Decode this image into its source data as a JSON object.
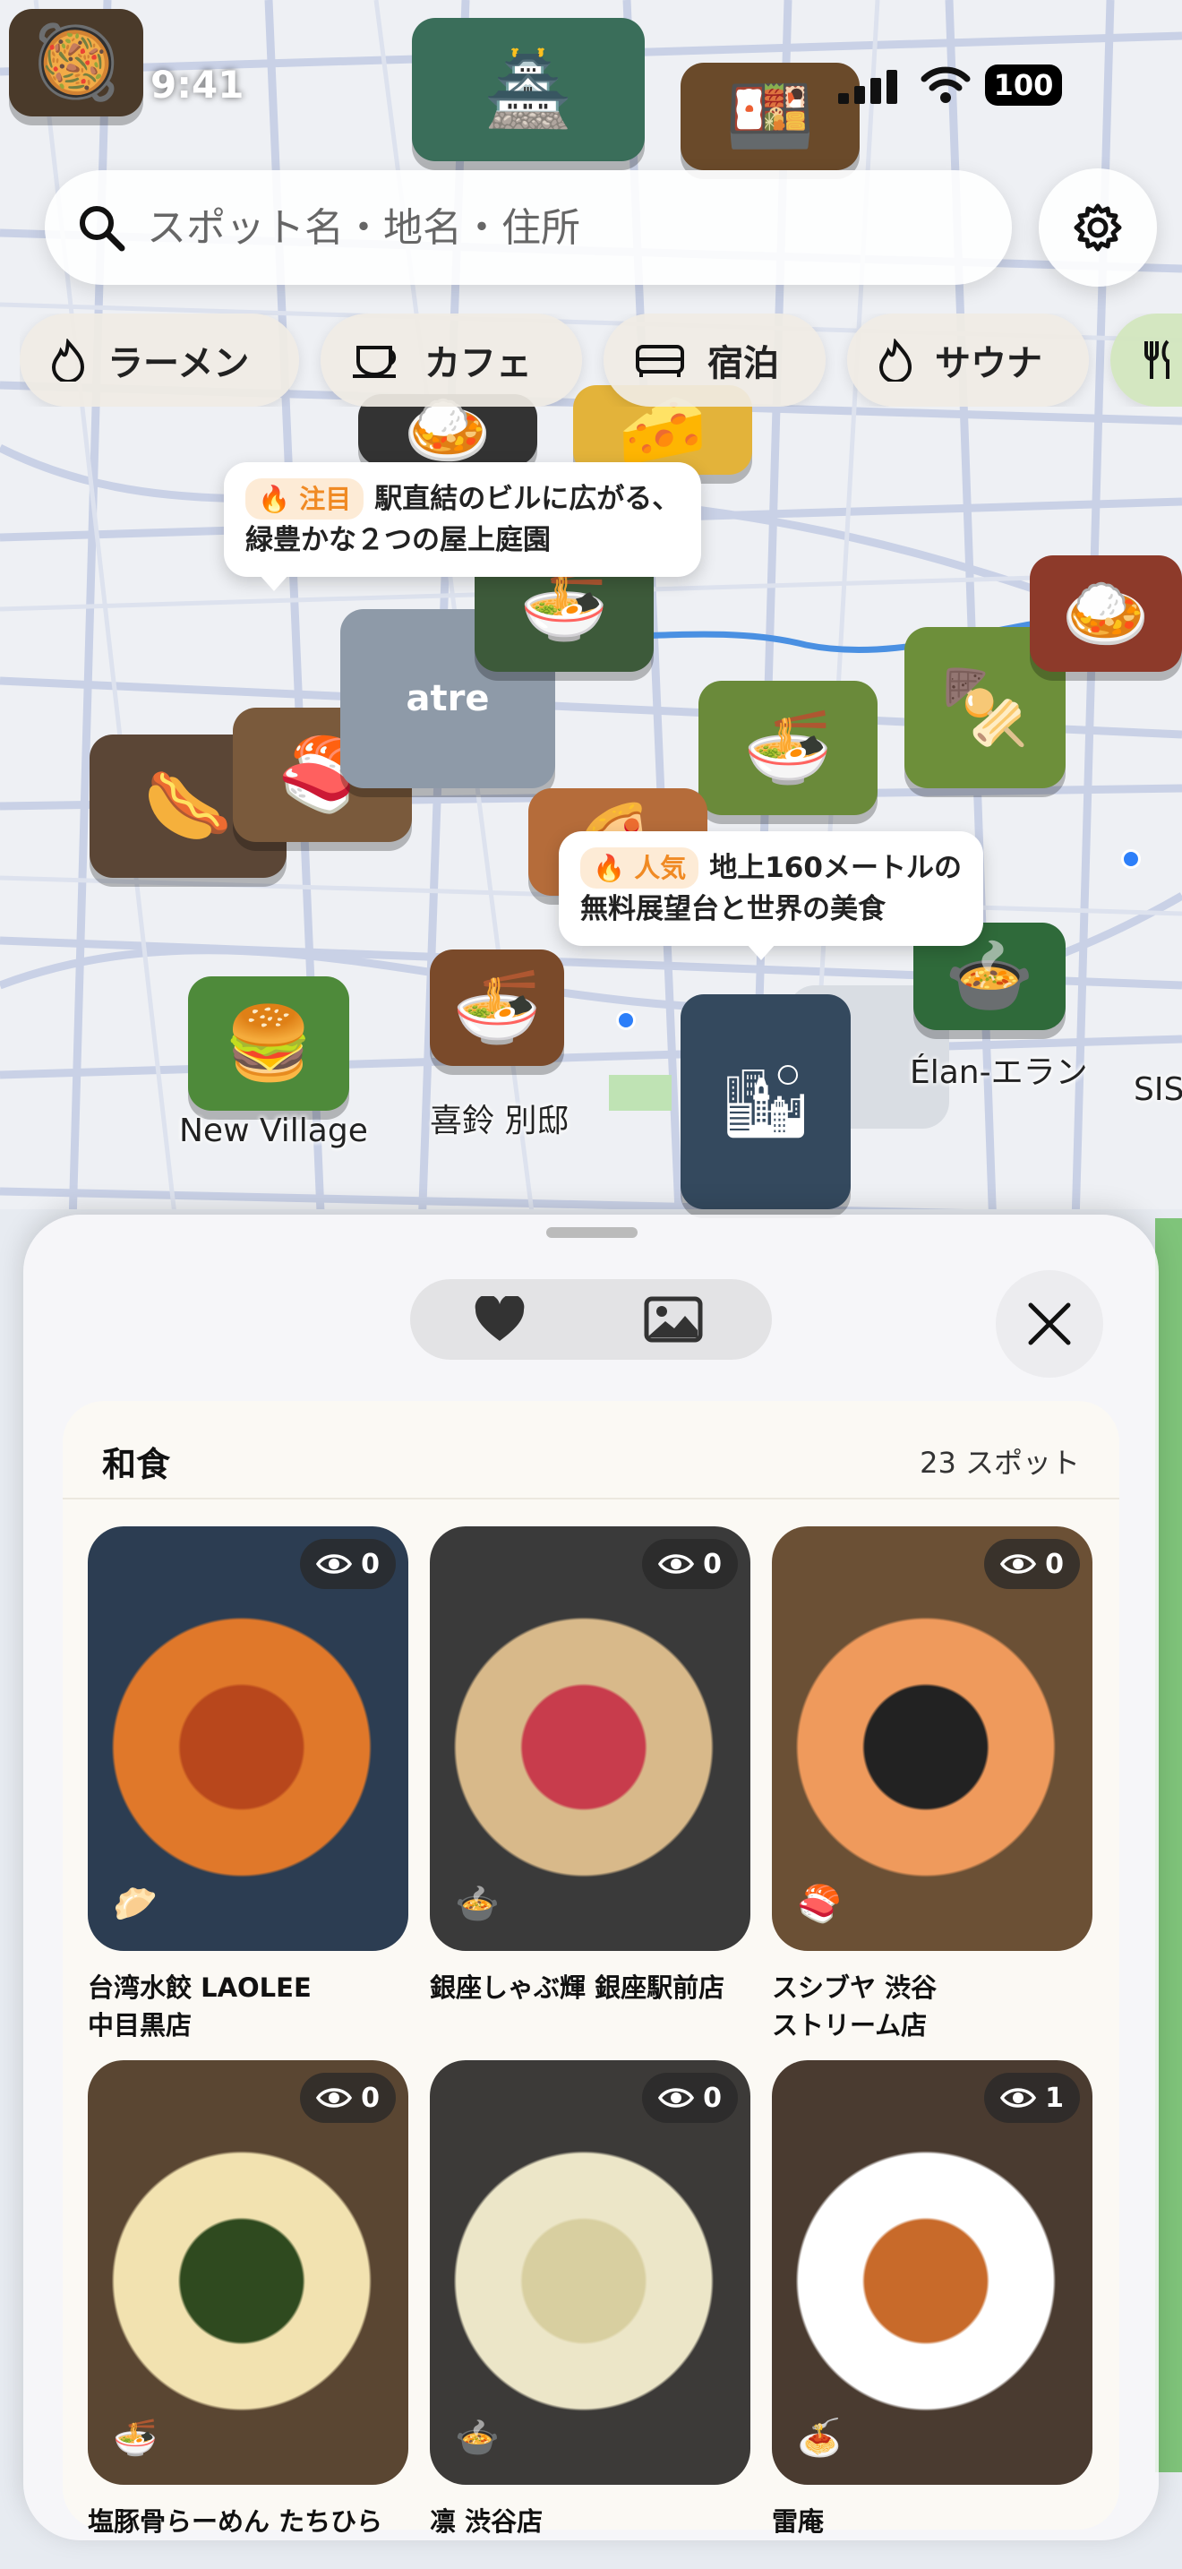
{
  "status_bar": {
    "time": "9:41",
    "battery": "100"
  },
  "search": {
    "placeholder": "スポット名・地名・住所"
  },
  "chips": [
    {
      "label": "ラーメン",
      "icon": "flame-icon"
    },
    {
      "label": "カフェ",
      "icon": "coffee-cup-icon"
    },
    {
      "label": "宿泊",
      "icon": "bed-icon"
    },
    {
      "label": "サウナ",
      "icon": "flame-icon"
    },
    {
      "label": "",
      "icon": "fork-knife-icon"
    }
  ],
  "map": {
    "callouts": [
      {
        "tag": "注目",
        "line1": "駅直結のビルに広がる、",
        "line2": "緑豊かな２つの屋上庭園"
      },
      {
        "tag": "人気",
        "line1": "地上160メートルの",
        "line2": "無料展望台と世界の美食"
      }
    ],
    "labels": {
      "new_village": "New Village",
      "kirei": "喜鈴 別邸",
      "elan": "Élan-エラン",
      "sis": "SIS",
      "atre": "atre"
    }
  },
  "sheet": {
    "category": "和食",
    "count": "23 スポット",
    "spots": [
      {
        "name": "台湾水餃 LAOLEE\n中目黒店",
        "views": "0",
        "photo_colors": [
          "#2c3d52",
          "#e0782a",
          "#b8471c"
        ]
      },
      {
        "name": "銀座しゃぶ輝 銀座駅前店",
        "views": "0",
        "photo_colors": [
          "#3a3a3a",
          "#d8b98a",
          "#c83c4c"
        ]
      },
      {
        "name": "スシブヤ 渋谷\nストリーム店",
        "views": "0",
        "photo_colors": [
          "#6b5035",
          "#ef9a5c",
          "#222222"
        ]
      },
      {
        "name": "塩豚骨らーめん たちひら",
        "views": "0",
        "photo_colors": [
          "#5a4632",
          "#f2e2b0",
          "#2f4a1f"
        ]
      },
      {
        "name": "凛 渋谷店",
        "views": "0",
        "photo_colors": [
          "#3c3a38",
          "#ece6c8",
          "#d8cfa0"
        ]
      },
      {
        "name": "雷庵",
        "views": "1",
        "photo_colors": [
          "#4a3b30",
          "#ffffff",
          "#c86a2a"
        ]
      }
    ]
  }
}
